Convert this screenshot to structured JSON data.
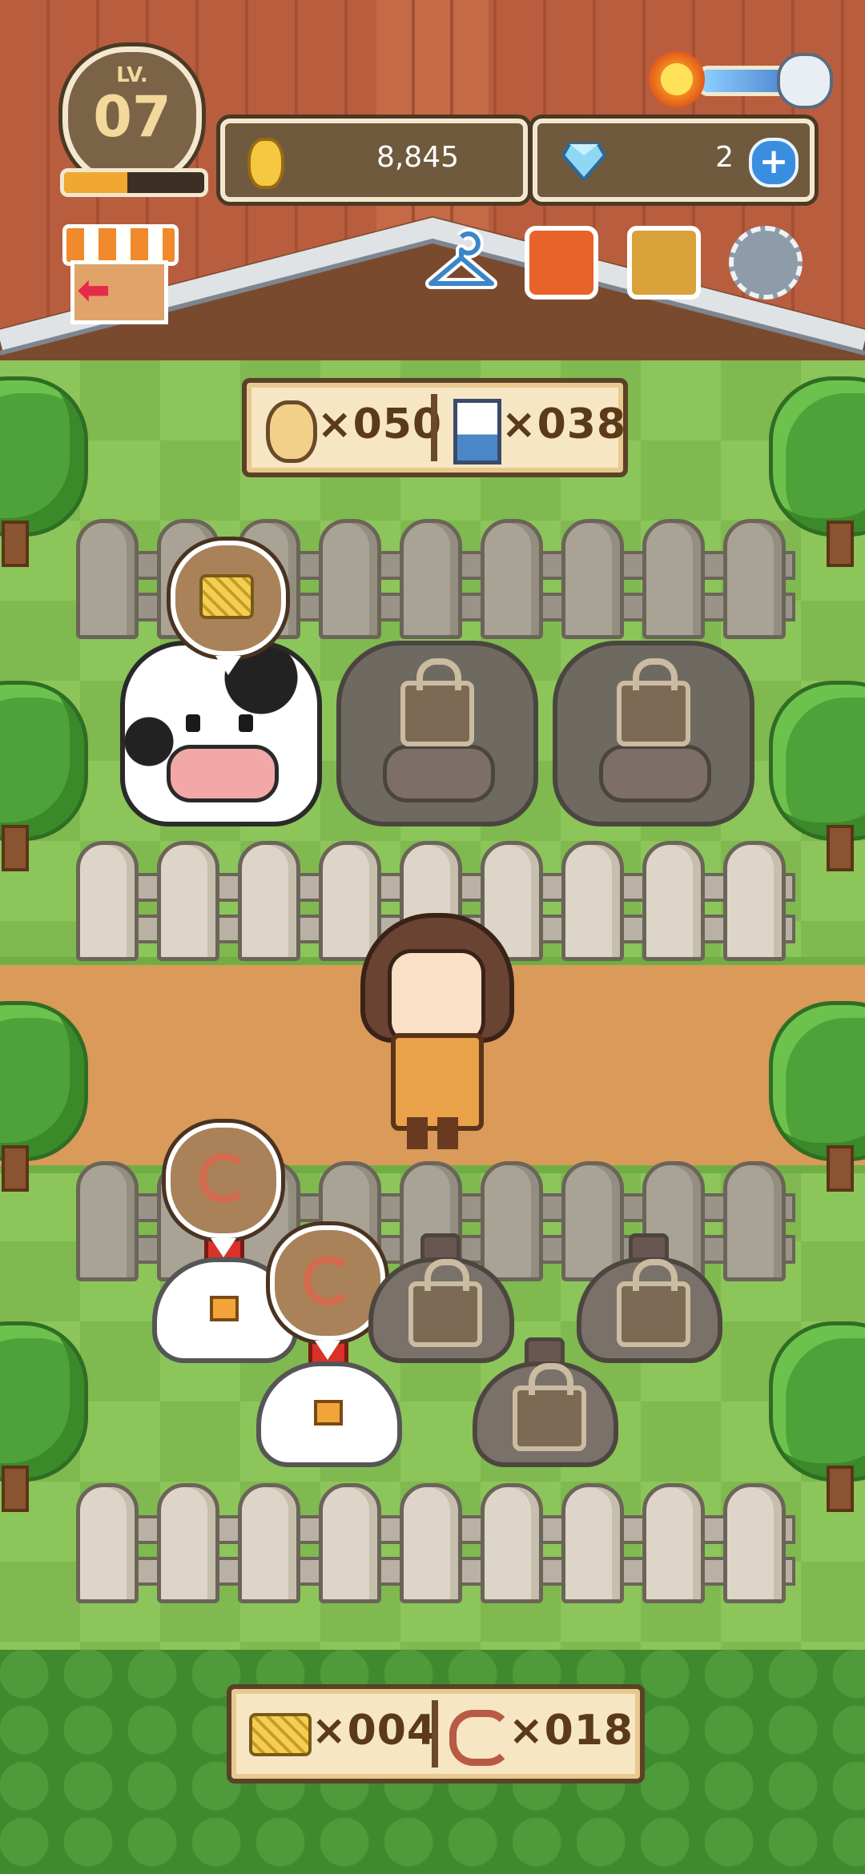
{
  "hud": {
    "level": {
      "prefix": "LV.",
      "value": "07",
      "xp_progress": 0.45
    },
    "currencies": {
      "coins": {
        "icon": "coin-icon",
        "value": "8,845"
      },
      "gems": {
        "icon": "diamond-icon",
        "value": "2",
        "add_icon": "plus-icon"
      }
    },
    "day_night": {
      "start_icon": "sun-icon",
      "end_icon": "moon-icon",
      "progress": 0.7
    }
  },
  "toolbar": [
    {
      "name": "shop-exit-button",
      "icon": "shop-exit-icon"
    },
    {
      "name": "hanger-button",
      "icon": "hanger-icon"
    },
    {
      "name": "sofa-button",
      "icon": "sofa-icon"
    },
    {
      "name": "bag-button",
      "icon": "bag-icon"
    },
    {
      "name": "settings-button",
      "icon": "gear-icon"
    }
  ],
  "products": {
    "egg": {
      "icon": "egg-icon",
      "count": "×050"
    },
    "milk": {
      "icon": "milk-icon",
      "count": "×038"
    }
  },
  "feed": {
    "hay": {
      "icon": "hay-icon",
      "count": "×004"
    },
    "worm": {
      "icon": "worm-icon",
      "count": "×018"
    }
  },
  "animals": {
    "cows": [
      {
        "state": "unlocked",
        "request": "hay-icon"
      },
      {
        "state": "locked"
      },
      {
        "state": "locked"
      }
    ],
    "chickens": [
      {
        "state": "unlocked",
        "request": "worm-icon"
      },
      {
        "state": "unlocked",
        "request": "worm-icon"
      },
      {
        "state": "locked"
      },
      {
        "state": "locked"
      },
      {
        "state": "locked"
      }
    ]
  },
  "colors": {
    "roof": "#b85e3e",
    "grass": "#8cc55a",
    "path": "#d99a5a",
    "panel": "#6f5a3d",
    "accent": "#f0a830"
  }
}
